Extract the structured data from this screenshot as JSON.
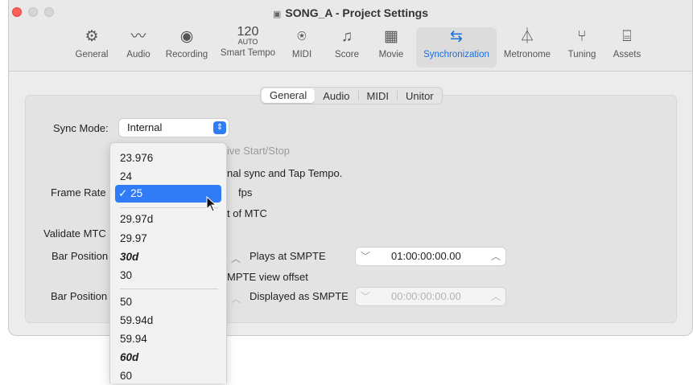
{
  "window": {
    "doc_icon": "document-icon",
    "title": "SONG_A - Project Settings"
  },
  "toolbar": [
    {
      "label": "General",
      "icon": "gear-icon",
      "glyph": "⚙"
    },
    {
      "label": "Audio",
      "icon": "waveform-icon",
      "glyph": "〰"
    },
    {
      "label": "Recording",
      "icon": "record-icon",
      "glyph": "◉"
    },
    {
      "label": "Smart Tempo",
      "icon": "tempo-display",
      "tempo_value": "120",
      "tempo_mode": "AUTO"
    },
    {
      "label": "MIDI",
      "icon": "midi-icon",
      "glyph": "⍟"
    },
    {
      "label": "Score",
      "icon": "score-icon",
      "glyph": "♫"
    },
    {
      "label": "Movie",
      "icon": "film-icon",
      "glyph": "▦"
    },
    {
      "label": "Synchronization",
      "icon": "sync-icon",
      "glyph": "⇆",
      "active": true
    },
    {
      "label": "Metronome",
      "icon": "metronome-icon",
      "glyph": "⏃"
    },
    {
      "label": "Tuning",
      "icon": "tuning-fork-icon",
      "glyph": "⑂"
    },
    {
      "label": "Assets",
      "icon": "briefcase-icon",
      "glyph": "⌸"
    }
  ],
  "tabs": [
    "General",
    "Audio",
    "MIDI",
    "Unitor"
  ],
  "selected_tab": "General",
  "form": {
    "sync_mode_label": "Sync Mode:",
    "sync_mode_value": "Internal",
    "auto_enable_text": "ive Start/Stop",
    "internal_sync_text": "nal sync and Tap Tempo.",
    "frame_rate_label": "Frame Rate",
    "fps_label": "fps",
    "mtc_text": "t of MTC",
    "validate_mtc_label": "Validate MTC",
    "bar_position_label_1": "Bar Position",
    "plays_at_smpte_label": "Plays at SMPTE",
    "smpte_value_1": "01:00:00:00.00",
    "smpte_view_offset_text": "MPTE view offset",
    "bar_position_label_2": "Bar Position",
    "displayed_as_smpte_label": "Displayed as SMPTE",
    "smpte_value_2": "00:00:00:00.00"
  },
  "frame_rate_menu": {
    "selected": "25",
    "checkmark": "✓",
    "items": [
      {
        "label": "23.976",
        "bold": false
      },
      {
        "label": "24",
        "bold": false
      },
      {
        "label": "25",
        "bold": false,
        "selected": true
      },
      {
        "label": "29.97d",
        "bold": false
      },
      {
        "label": "29.97",
        "bold": false
      },
      {
        "label": "30d",
        "bold": true
      },
      {
        "label": "30",
        "bold": false
      },
      {
        "label": "50",
        "bold": false
      },
      {
        "label": "59.94d",
        "bold": false
      },
      {
        "label": "59.94",
        "bold": false
      },
      {
        "label": "60d",
        "bold": true
      },
      {
        "label": "60",
        "bold": false
      }
    ]
  },
  "colors": {
    "accent": "#2f7cf6",
    "close_button": "#fe5f57"
  }
}
